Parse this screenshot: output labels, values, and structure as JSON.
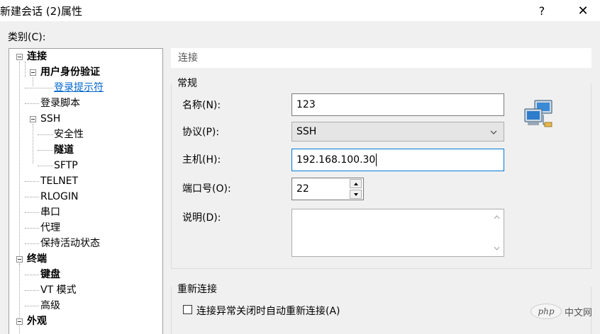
{
  "window": {
    "title": "新建会话 (2)属性",
    "help_label": "?",
    "close_label": "✕"
  },
  "category_label": "类别(C):",
  "tree": {
    "items": [
      {
        "label": "连接",
        "bold": true
      },
      {
        "label": "用户身份验证",
        "bold": true
      },
      {
        "label": "登录提示符",
        "selected_link": true
      },
      {
        "label": "登录脚本"
      },
      {
        "label": "SSH"
      },
      {
        "label": "安全性"
      },
      {
        "label": "隧道",
        "bold": true
      },
      {
        "label": "SFTP"
      },
      {
        "label": "TELNET"
      },
      {
        "label": "RLOGIN"
      },
      {
        "label": "串口"
      },
      {
        "label": "代理"
      },
      {
        "label": "保持活动状态"
      },
      {
        "label": "终端",
        "bold": true
      },
      {
        "label": "键盘",
        "bold": true
      },
      {
        "label": "VT 模式"
      },
      {
        "label": "高级"
      },
      {
        "label": "外观",
        "bold": true
      },
      {
        "label": "····"
      }
    ]
  },
  "section_header": "连接",
  "general": {
    "title": "常规",
    "name_label": "名称(N):",
    "name_value": "123",
    "protocol_label": "协议(P):",
    "protocol_value": "SSH",
    "host_label": "主机(H):",
    "host_value": "192.168.100.30",
    "port_label": "端口号(O):",
    "port_value": "22",
    "desc_label": "说明(D):",
    "desc_value": ""
  },
  "reconnect": {
    "title": "重新连接",
    "checkbox_label": "连接异常关闭时自动重新连接(A)",
    "checked": false
  },
  "watermark": {
    "logo": "php",
    "text": "中文网"
  },
  "icons": [
    "network-computers-icon",
    "combo-chevron-down-icon",
    "spin-up-icon",
    "spin-down-icon"
  ]
}
